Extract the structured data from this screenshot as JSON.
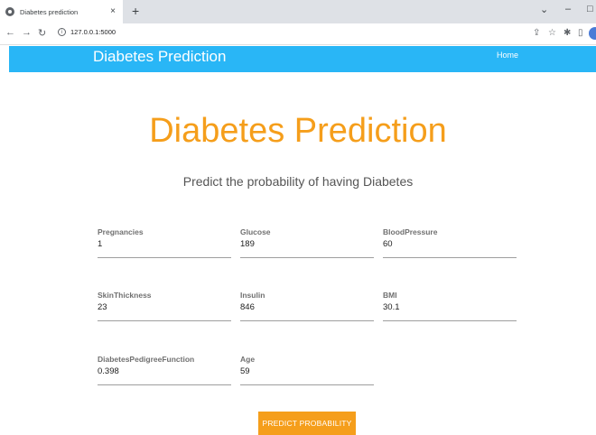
{
  "browser": {
    "tab_title": "Diabetes prediction",
    "tab_close": "×",
    "new_tab": "+",
    "url": "127.0.0.1:5000"
  },
  "navbar": {
    "brand": "Diabetes Prediction",
    "home_link": "Home"
  },
  "main": {
    "title": "Diabetes Prediction",
    "subtitle": "Predict the probability of having Diabetes",
    "fields": [
      {
        "label": "Pregnancies",
        "value": "1"
      },
      {
        "label": "Glucose",
        "value": "189"
      },
      {
        "label": "BloodPressure",
        "value": "60"
      },
      {
        "label": "SkinThickness",
        "value": "23"
      },
      {
        "label": "Insulin",
        "value": "846"
      },
      {
        "label": "BMI",
        "value": "30.1"
      },
      {
        "label": "DiabetesPedigreeFunction",
        "value": "0.398"
      },
      {
        "label": "Age",
        "value": "59"
      }
    ],
    "submit_label": "PREDICT PROBABILITY"
  },
  "colors": {
    "navbar": "#29b6f6",
    "accent": "#f59e1b"
  }
}
